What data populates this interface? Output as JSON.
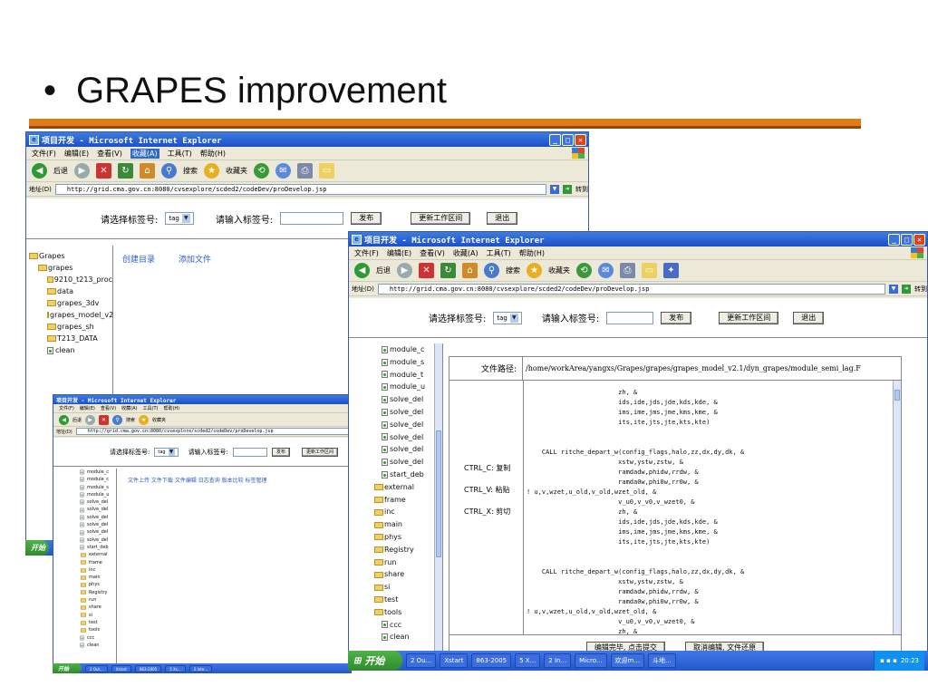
{
  "slide": {
    "bullet": "•",
    "title": "GRAPES improvement"
  },
  "ie": {
    "window_title": "项目开发 - Microsoft Internet Explorer",
    "menu": [
      "文件(F)",
      "编辑(E)",
      "查看(V)",
      "收藏(A)",
      "工具(T)",
      "帮助(H)"
    ],
    "toolbar": {
      "back": "后退",
      "search": "搜索",
      "favorites": "收藏夹"
    },
    "address_label": "地址(D)",
    "url": "http://grid.cma.gov.cn:8080/cvsexplore/scded2/codeDev/proDevelop.jsp",
    "go": "转到"
  },
  "tagbar": {
    "select_label": "请选择标签号:",
    "select_value": "tag",
    "input_label": "请输入标签号:",
    "publish": "发布",
    "update": "更新工作区间",
    "exit": "退出"
  },
  "back_window": {
    "links": {
      "create_dir": "创建目录",
      "add_file": "添加文件"
    },
    "tree": [
      {
        "name": "Grapes",
        "type": "folder",
        "level": 0
      },
      {
        "name": "grapes",
        "type": "folder",
        "level": 1
      },
      {
        "name": "9210_t213_proc",
        "type": "folder",
        "level": 2
      },
      {
        "name": "data",
        "type": "folder",
        "level": 2
      },
      {
        "name": "grapes_3dv",
        "type": "folder",
        "level": 2
      },
      {
        "name": "grapes_model_v2",
        "type": "folder",
        "level": 2
      },
      {
        "name": "grapes_sh",
        "type": "folder",
        "level": 2
      },
      {
        "name": "T213_DATA",
        "type": "folder",
        "level": 2
      },
      {
        "name": "clean",
        "type": "file",
        "level": 2
      }
    ]
  },
  "middle_window": {
    "links": "文件上传 文件下载 文件编辑 日志查询 版本比较 标签管理",
    "tree": [
      "module_c",
      "module_c",
      "module_s",
      "module_u",
      "solve_del",
      "solve_del",
      "solve_del",
      "solve_del",
      "solve_del",
      "solve_del",
      "start_deb",
      "external",
      "frame",
      "inc",
      "main",
      "phys",
      "Registry",
      "run",
      "share",
      "si",
      "test",
      "tools",
      "ccc",
      "clean"
    ],
    "taskbar": [
      "2 Out...",
      "Xstart",
      "863-2005",
      "5 Xs...",
      "2 Inte...",
      "Micros..."
    ]
  },
  "front_window": {
    "tree": [
      {
        "name": "module_c",
        "type": "file"
      },
      {
        "name": "module_s",
        "type": "file"
      },
      {
        "name": "module_t",
        "type": "file"
      },
      {
        "name": "module_u",
        "type": "file"
      },
      {
        "name": "solve_del",
        "type": "file"
      },
      {
        "name": "solve_del",
        "type": "file"
      },
      {
        "name": "solve_del",
        "type": "file"
      },
      {
        "name": "solve_del",
        "type": "file"
      },
      {
        "name": "solve_del",
        "type": "file"
      },
      {
        "name": "solve_del",
        "type": "file"
      },
      {
        "name": "start_deb",
        "type": "file"
      },
      {
        "name": "external",
        "type": "folder"
      },
      {
        "name": "frame",
        "type": "folder"
      },
      {
        "name": "inc",
        "type": "folder"
      },
      {
        "name": "main",
        "type": "folder"
      },
      {
        "name": "phys",
        "type": "folder"
      },
      {
        "name": "Registry",
        "type": "folder"
      },
      {
        "name": "run",
        "type": "folder"
      },
      {
        "name": "share",
        "type": "folder"
      },
      {
        "name": "si",
        "type": "folder"
      },
      {
        "name": "test",
        "type": "folder"
      },
      {
        "name": "tools",
        "type": "folder"
      },
      {
        "name": "ccc",
        "type": "file"
      },
      {
        "name": "clean",
        "type": "file"
      }
    ],
    "path_label": "文件路径:",
    "path_value": "/home/workArea/yangxs/Grapes/grapes/grapes_model_v2.1/dyn_grapes/module_semi_lag.F",
    "shortcuts": [
      "CTRL_C: 复制",
      "CTRL_V: 粘贴",
      "CTRL_X: 剪切"
    ],
    "code_lines": [
      "                        zh, &",
      "                        ids,ide,jds,jde,kds,kde, &",
      "                        ims,ime,jms,jme,kms,kme, &",
      "                        its,ite,jts,jte,kts,kte)",
      "",
      "",
      "    CALL ritche_depart_w(config_flags,halo,zz,dx,dy,dk, &",
      "                        xstw,ystw,zstw, &",
      "                        ramdadw,phidw,rrdw, &",
      "                        ramda0w,phi0w,rr0w, &",
      "! u,v,wzet,u_old,v_old,wzet_old, &",
      "                        v_u0,v_v0,v_wzet0, &",
      "                        zh, &",
      "                        ids,ide,jds,jde,kds,kde, &",
      "                        ims,ime,jms,jme,kms,kme, &",
      "                        its,ite,jts,jte,kts,kte)",
      "",
      "",
      "    CALL ritche_depart_w(config_flags,halo,zz,dx,dy,dk, &",
      "                        xstw,ystw,zstw, &",
      "                        ramdadw,phidw,rrdw, &",
      "                        ramda0w,phi0w,rr0w, &",
      "! u,v,wzet,u_old,v_old,wzet_old, &",
      "                        v_u0,v_v0,v_wzet0, &",
      "                        zh, &"
    ],
    "submit": "编辑完毕, 点击提交",
    "cancel": "取消编辑, 文件还原"
  },
  "taskbar": {
    "start": "开始",
    "items": [
      "2 Ou...",
      "Xstart",
      "863-2005",
      "5 X...",
      "2 In...",
      "Micro...",
      "欢迎m...",
      "斗地..."
    ],
    "clock": "20:23"
  }
}
